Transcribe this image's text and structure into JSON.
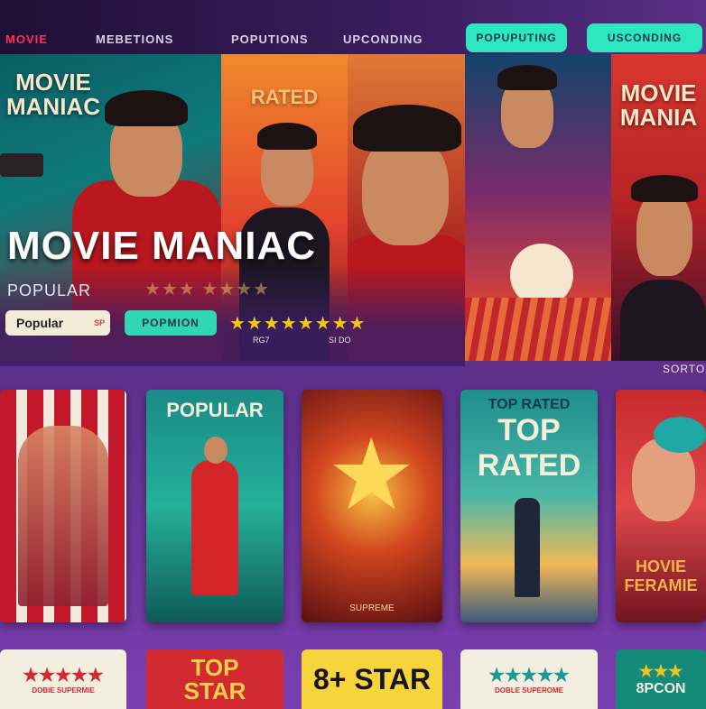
{
  "nav": {
    "brand": "MOVIE",
    "items": [
      "MEBETIONS",
      "POPUTIONS",
      "UPCONDING"
    ],
    "pills": [
      "POPUPUTING",
      "USCONDING"
    ]
  },
  "hero": {
    "poster1_title": "MOVIE\nMANIAC",
    "poster2_title": "RATED",
    "poster5_title": "MOVIE\nMANIA",
    "main_title": "MOVIE MANIAC",
    "sub_label": "POPULAR",
    "button_primary": "Popular",
    "button_primary_extra": "SP",
    "button_secondary": "POPMION",
    "stars_row_faint": "★★★ ★★★★",
    "stars_row_bright": "★★★★★★★★",
    "caption_left": "RG7",
    "caption_right": "SI DO",
    "sort_label": "SORTO"
  },
  "cards": [
    {
      "title": "",
      "caption": ""
    },
    {
      "title": "POPULAR",
      "caption": ""
    },
    {
      "title": "",
      "caption": "SUPREME"
    },
    {
      "title_small": "TOP RATED",
      "title": "TOP\nRATED",
      "caption": ""
    },
    {
      "title": "HOVIE\nFERAMIE",
      "caption": ""
    }
  ],
  "bottom_cards": [
    {
      "label": "★★★★★",
      "sub": "DOBIE SUPERMIE"
    },
    {
      "label": "TOP\nSTAR",
      "sub": ""
    },
    {
      "label": "8+ STAR",
      "sub": ""
    },
    {
      "label": "★★★★★",
      "sub": "DOBLE SUPEROME"
    },
    {
      "label": "★★★",
      "sub": "8PCON"
    }
  ],
  "colors": {
    "accent_teal": "#2ee6c0",
    "brand_red": "#ff2d55",
    "star_gold": "#f5c518",
    "bg_purple": "#5a2d86"
  }
}
